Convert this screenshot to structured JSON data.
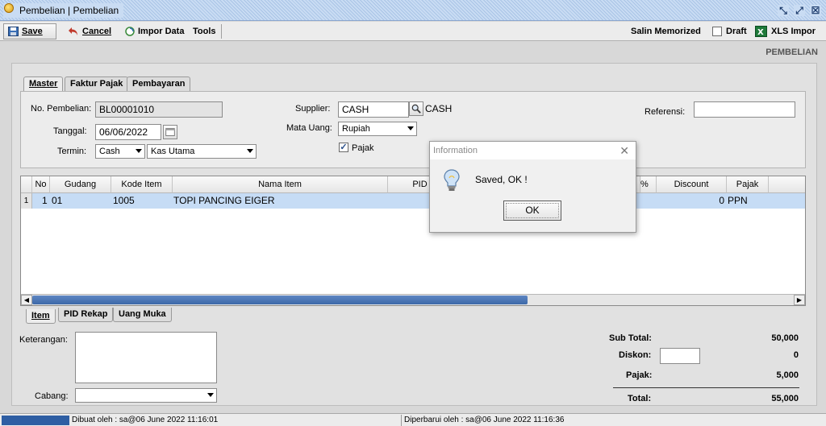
{
  "window": {
    "title": "Pembelian | Pembelian"
  },
  "toolbar": {
    "save": "Save",
    "cancel": "Cancel",
    "impor_data": "Impor Data",
    "tools": "Tools",
    "salin_memorized": "Salin Memorized",
    "draft": "Draft",
    "xls_impor": "XLS Impor"
  },
  "page_label": "PEMBELIAN",
  "tabs": [
    "Master",
    "Faktur Pajak",
    "Pembayaran"
  ],
  "form": {
    "no_pembelian_label": "No. Pembelian:",
    "no_pembelian": "BL00001010",
    "tanggal_label": "Tanggal:",
    "tanggal": "06/06/2022",
    "termin_label": "Termin:",
    "termin": "Cash",
    "kas": "Kas Utama",
    "supplier_label": "Supplier:",
    "supplier": "CASH",
    "supplier_name": "CASH",
    "mata_uang_label": "Mata Uang:",
    "mata_uang": "Rupiah",
    "pajak_label": "Pajak",
    "referensi_label": "Referensi:",
    "referensi": ""
  },
  "grid": {
    "columns": [
      "No",
      "Gudang",
      "Kode Item",
      "Nama Item",
      "PID",
      "%",
      "Discount",
      "Pajak"
    ],
    "rows": [
      {
        "rownum": "1",
        "no": "1",
        "gudang": "01",
        "kode": "1005",
        "nama": "TOPI PANCING EIGER",
        "pid": "",
        "discount": "0",
        "pajak": "PPN"
      }
    ]
  },
  "bottom_tabs": [
    "Item",
    "PID Rekap",
    "Uang Muka"
  ],
  "bottom": {
    "keterangan_label": "Keterangan:",
    "cabang_label": "Cabang:",
    "cabang": "",
    "sub_total_label": "Sub Total:",
    "sub_total": "50,000",
    "diskon_label": "Diskon:",
    "diskon": "0",
    "pajak_label": "Pajak:",
    "pajak": "5,000",
    "total_label": "Total:",
    "total": "55,000"
  },
  "status": {
    "created": "Dibuat oleh : sa@06 June 2022  11:16:01",
    "updated": "Diperbarui oleh : sa@06 June 2022  11:16:36"
  },
  "dialog": {
    "title": "Information",
    "message": "Saved, OK !",
    "ok": "OK"
  },
  "colors": {
    "accent": "#2e5ea3",
    "selection": "#c6dcf5",
    "title_bar": "#c9dcf3"
  }
}
